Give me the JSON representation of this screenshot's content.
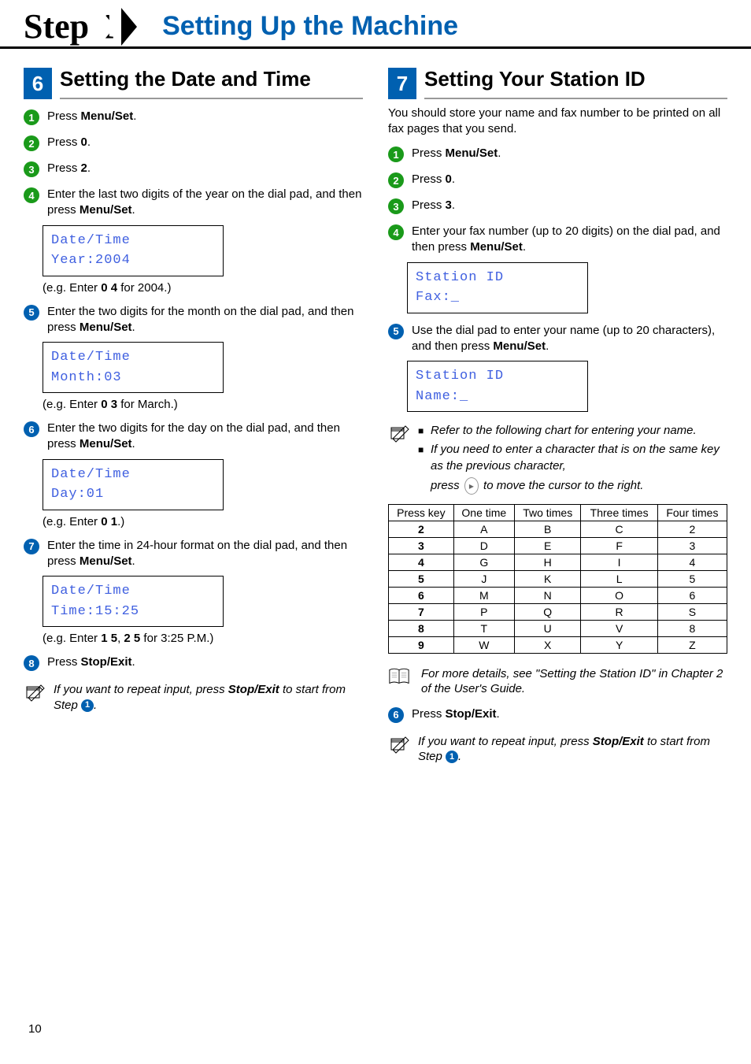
{
  "header": {
    "step": "Step 1",
    "title": "Setting Up the Machine"
  },
  "section6": {
    "num": "6",
    "title": "Setting the Date and Time",
    "steps": {
      "s1": "Press ",
      "s1b": "Menu/Set",
      "s1c": ".",
      "s2": "Press ",
      "s2b": "0",
      "s2c": ".",
      "s3": "Press ",
      "s3b": "2",
      "s3c": ".",
      "s4": "Enter the last two digits of the year on the dial pad, and then press ",
      "s4b": "Menu/Set",
      "s4c": ".",
      "lcd4a": "Date/Time",
      "lcd4b": "Year:2004",
      "eg4a": "(e.g. Enter ",
      "eg4b": "0 4",
      "eg4c": " for 2004.)",
      "s5": "Enter the two digits for the month on the dial pad, and then press ",
      "s5b": "Menu/Set",
      "s5c": ".",
      "lcd5a": "Date/Time",
      "lcd5b": "Month:03",
      "eg5a": "(e.g. Enter ",
      "eg5b": "0 3",
      "eg5c": " for March.)",
      "s6": "Enter the two digits for the day on the dial pad, and then press ",
      "s6b": "Menu/Set",
      "s6c": ".",
      "lcd6a": "Date/Time",
      "lcd6b": "Day:01",
      "eg6a": "(e.g. Enter ",
      "eg6b": "0 1",
      "eg6c": ".)",
      "s7": "Enter the time in 24-hour format on the dial pad, and then press ",
      "s7b": "Menu/Set",
      "s7c": ".",
      "lcd7a": "Date/Time",
      "lcd7b": "Time:15:25",
      "eg7a": "(e.g. Enter ",
      "eg7b": "1 5",
      "eg7c": ", ",
      "eg7d": "2 5",
      "eg7e": " for 3:25 P.M.)",
      "s8": "Press ",
      "s8b": "Stop/Exit",
      "s8c": ".",
      "note": "If you want to repeat input, press ",
      "noteb": "Stop/Exit",
      "notec": " to start from Step ",
      "noted": "1",
      "notee": "."
    }
  },
  "section7": {
    "num": "7",
    "title": "Setting Your Station ID",
    "intro": "You should store your name and fax number to be printed on all fax pages that you send.",
    "steps": {
      "s1": "Press ",
      "s1b": "Menu/Set",
      "s1c": ".",
      "s2": "Press ",
      "s2b": "0",
      "s2c": ".",
      "s3": "Press ",
      "s3b": "3",
      "s3c": ".",
      "s4": "Enter your fax number (up to 20 digits) on the dial pad, and then press ",
      "s4b": "Menu/Set",
      "s4c": ".",
      "lcd4a": "Station ID",
      "lcd4b": "Fax:_",
      "s5": "Use the dial pad to enter your name (up to 20 characters), and then press ",
      "s5b": "Menu/Set",
      "s5c": ".",
      "lcd5a": "Station ID",
      "lcd5b": "Name:_",
      "noteA": "Refer to the following chart for entering your name.",
      "noteB": "If you need to enter a character that is on the same key as the previous character, ",
      "noteB2a": "press ",
      "noteB2b": " to move the cursor to the right.",
      "ref": "For more details, see \"Setting the Station ID\" in Chapter 2 of the User's Guide.",
      "s6": "Press ",
      "s6b": "Stop/Exit",
      "s6c": ".",
      "note2": "If you want to repeat input, press ",
      "note2b": "Stop/Exit",
      "note2c": " to start from Step ",
      "note2d": "1",
      "note2e": "."
    }
  },
  "chart_data": {
    "type": "table",
    "title": "",
    "headers": [
      "Press key",
      "One time",
      "Two times",
      "Three times",
      "Four times"
    ],
    "rows": [
      [
        "2",
        "A",
        "B",
        "C",
        "2"
      ],
      [
        "3",
        "D",
        "E",
        "F",
        "3"
      ],
      [
        "4",
        "G",
        "H",
        "I",
        "4"
      ],
      [
        "5",
        "J",
        "K",
        "L",
        "5"
      ],
      [
        "6",
        "M",
        "N",
        "O",
        "6"
      ],
      [
        "7",
        "P",
        "Q",
        "R",
        "S"
      ],
      [
        "8",
        "T",
        "U",
        "V",
        "8"
      ],
      [
        "9",
        "W",
        "X",
        "Y",
        "Z"
      ]
    ]
  },
  "page_number": "10"
}
